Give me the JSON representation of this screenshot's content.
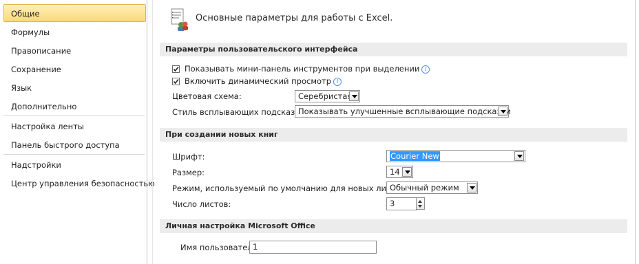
{
  "sidebar": {
    "items": [
      {
        "label": "Общие",
        "active": true
      },
      {
        "label": "Формулы"
      },
      {
        "label": "Правописание"
      },
      {
        "label": "Сохранение"
      },
      {
        "label": "Язык"
      },
      {
        "label": "Дополнительно"
      },
      {
        "label": "Настройка ленты"
      },
      {
        "label": "Панель быстрого доступа"
      },
      {
        "label": "Надстройки"
      },
      {
        "label": "Центр управления безопасностью"
      }
    ]
  },
  "header": {
    "title": "Основные параметры для работы с Excel."
  },
  "ui_section": {
    "title": "Параметры пользовательского интерфейса",
    "mini_toolbar": {
      "label": "Показывать мини-панель инструментов при выделении",
      "checked": true
    },
    "live_preview": {
      "label": "Включить динамический просмотр",
      "checked": true
    },
    "color_scheme": {
      "label": "Цветовая схема:",
      "value": "Серебристая"
    },
    "tooltip_style": {
      "label": "Стиль всплывающих подсказок:",
      "value": "Показывать улучшенные всплывающие подсказки"
    }
  },
  "new_books_section": {
    "title": "При создании новых книг",
    "font": {
      "label": "Шрифт:",
      "value": "Courier New"
    },
    "size": {
      "label": "Размер:",
      "value": "14"
    },
    "view_mode": {
      "label": "Режим, используемый по умолчанию для новых листов:",
      "value": "Обычный режим"
    },
    "sheets_count": {
      "label": "Число листов:",
      "value": "3"
    }
  },
  "personal_section": {
    "title": "Личная настройка Microsoft Office",
    "username": {
      "label": "Имя пользователя:",
      "value": "1"
    }
  },
  "colors": {
    "selection_highlight": "#3399ff",
    "active_nav": "#fcd978",
    "section_bar": "#ececec"
  }
}
